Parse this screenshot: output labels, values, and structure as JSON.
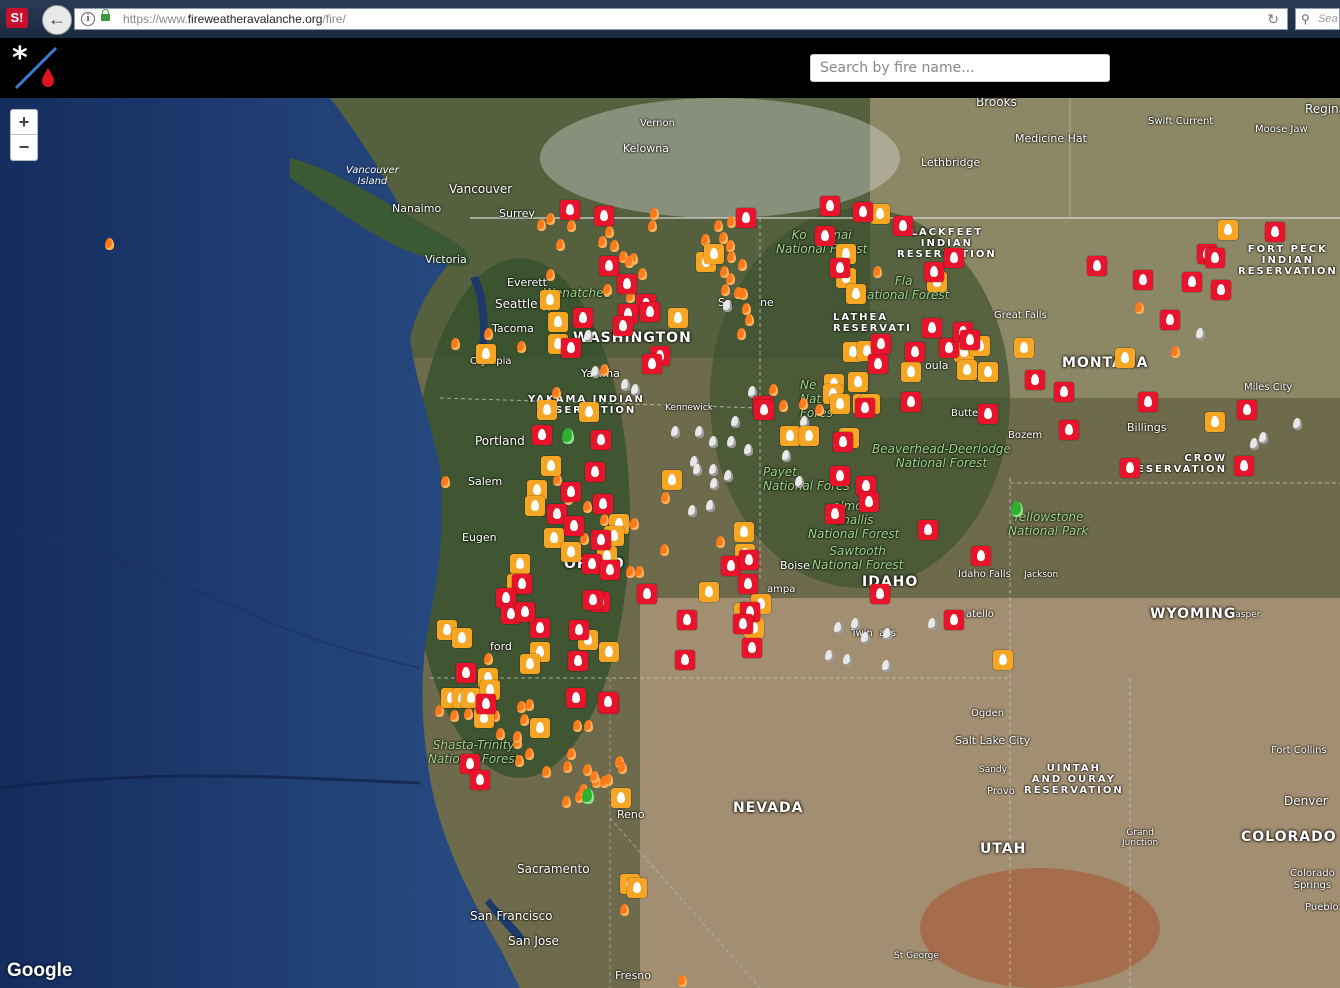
{
  "browser": {
    "logo_text": "S!",
    "url_prefix": "https://www.",
    "url_domain": "fireweatheravalanche.org",
    "url_path": "/fire/",
    "search_placeholder": "Sea"
  },
  "header": {
    "search_placeholder": "Search by fire name..."
  },
  "map": {
    "zoom_in": "+",
    "zoom_out": "−",
    "attribution": "Google",
    "places": [
      {
        "id": "brooks",
        "label": "Brooks"
      },
      {
        "id": "regina",
        "label": "Regina"
      },
      {
        "id": "swift-current",
        "label": "Swift Current"
      },
      {
        "id": "moose-jaw",
        "label": "Moose Jaw"
      },
      {
        "id": "medicine-hat",
        "label": "Medicine Hat"
      },
      {
        "id": "lethbridge",
        "label": "Lethbridge"
      },
      {
        "id": "vernon",
        "label": "Vernon"
      },
      {
        "id": "kelowna",
        "label": "Kelowna"
      },
      {
        "id": "vancouver",
        "label": "Vancouver"
      },
      {
        "id": "surrey",
        "label": "Surrey"
      },
      {
        "id": "nanaimo",
        "label": "Nanaimo"
      },
      {
        "id": "victoria",
        "label": "Victoria"
      },
      {
        "id": "everett",
        "label": "Everett"
      },
      {
        "id": "seattle",
        "label": "Seattle"
      },
      {
        "id": "tacoma",
        "label": "Tacoma"
      },
      {
        "id": "olympia",
        "label": "Olympia"
      },
      {
        "id": "yakima",
        "label": "Yakima"
      },
      {
        "id": "kennewick",
        "label": "Kennewick"
      },
      {
        "id": "portland",
        "label": "Portland"
      },
      {
        "id": "salem",
        "label": "Salem"
      },
      {
        "id": "eugene",
        "label": "Eugen"
      },
      {
        "id": "bend",
        "label": "Be"
      },
      {
        "id": "medford",
        "label": "ford"
      },
      {
        "id": "reno",
        "label": "Reno"
      },
      {
        "id": "sacramento",
        "label": "Sacramento"
      },
      {
        "id": "san-francisco",
        "label": "San Francisco"
      },
      {
        "id": "san-jose",
        "label": "San Jose"
      },
      {
        "id": "fresno",
        "label": "Fresno"
      },
      {
        "id": "spokane",
        "label": "Sp        ne"
      },
      {
        "id": "missoula",
        "label": "oula"
      },
      {
        "id": "great-falls",
        "label": "Great Falls"
      },
      {
        "id": "butte",
        "label": "Butte"
      },
      {
        "id": "bozeman",
        "label": "Bozem"
      },
      {
        "id": "billings",
        "label": "Billings"
      },
      {
        "id": "miles-city",
        "label": "Miles City"
      },
      {
        "id": "boise",
        "label": "Boise"
      },
      {
        "id": "nampa",
        "label": "ampa"
      },
      {
        "id": "twin-falls",
        "label": "Twin  alls"
      },
      {
        "id": "pocatello",
        "label": "atello"
      },
      {
        "id": "idaho-falls",
        "label": "Idaho Falls"
      },
      {
        "id": "jackson",
        "label": "Jackson"
      },
      {
        "id": "casper",
        "label": "Casper"
      },
      {
        "id": "ogden",
        "label": "Ogden"
      },
      {
        "id": "salt-lake-city",
        "label": "Salt Lake City"
      },
      {
        "id": "sandy",
        "label": "Sandy"
      },
      {
        "id": "provo",
        "label": "Provo"
      },
      {
        "id": "fort-collins",
        "label": "Fort Collins"
      },
      {
        "id": "denver",
        "label": "Denver"
      },
      {
        "id": "grand-junction",
        "label": "Grand\nJunction"
      },
      {
        "id": "colorado-springs",
        "label": "Colorado\nSprings"
      },
      {
        "id": "pueblo",
        "label": "Pueblo"
      },
      {
        "id": "st-george",
        "label": "St George"
      }
    ],
    "states": [
      {
        "id": "washington",
        "label": "WASHINGTON"
      },
      {
        "id": "oregon",
        "label": "OREGO"
      },
      {
        "id": "idaho",
        "label": "IDAHO"
      },
      {
        "id": "montana",
        "label": "MONTANA"
      },
      {
        "id": "wyoming",
        "label": "WYOMING"
      },
      {
        "id": "nevada",
        "label": "NEVADA"
      },
      {
        "id": "utah",
        "label": "UTAH"
      },
      {
        "id": "colorado",
        "label": "COLORADO"
      }
    ],
    "forests": [
      {
        "id": "wenatchee",
        "label": "Wenatchee\nN"
      },
      {
        "id": "kootenai",
        "label": "Ko       nai\nNational Forest"
      },
      {
        "id": "flathead",
        "label": "Fla\nNational Forest"
      },
      {
        "id": "ne-forest",
        "label": "Ne\nNat\nFores"
      },
      {
        "id": "beaverhead",
        "label": "Beaverhead-Deerlodge\nNational Forest"
      },
      {
        "id": "payette",
        "label": "Payet\nNational Fores"
      },
      {
        "id": "challis",
        "label": "almon-\nChallis\nNational Forest"
      },
      {
        "id": "sawtooth",
        "label": "Sawtooth\nNational Forest"
      },
      {
        "id": "yellowstone",
        "label": "Yellowstone\nNational Park"
      },
      {
        "id": "shasta",
        "label": "Shasta-Trinity\nNational Forest"
      }
    ],
    "reservations": [
      {
        "id": "blackfeet",
        "label": "LACKFEET\nINDIAN\nRESERVATION"
      },
      {
        "id": "flathead-res",
        "label": "LATHEA\nRESERVATI"
      },
      {
        "id": "fort-peck",
        "label": "FORT PECK\nINDIAN\nRESERVATION"
      },
      {
        "id": "yakama",
        "label": "YAKAMA INDIAN\nRESERVATION"
      },
      {
        "id": "crow",
        "label": "CROW\nESERVATION"
      },
      {
        "id": "uintah",
        "label": "UINTAH\nAND OURAY\nRESERVATION"
      }
    ],
    "islands": [
      {
        "id": "vancouver-island",
        "label": "Vancouver\nIsland"
      }
    ],
    "colors": {
      "large_fire": "#e8142b",
      "new_fire": "#f6a623",
      "hotspot": "#ff7a1a",
      "contained": "#e8e8e8",
      "complex": "#2fb02f",
      "ocean": "#1d3a6b"
    }
  }
}
